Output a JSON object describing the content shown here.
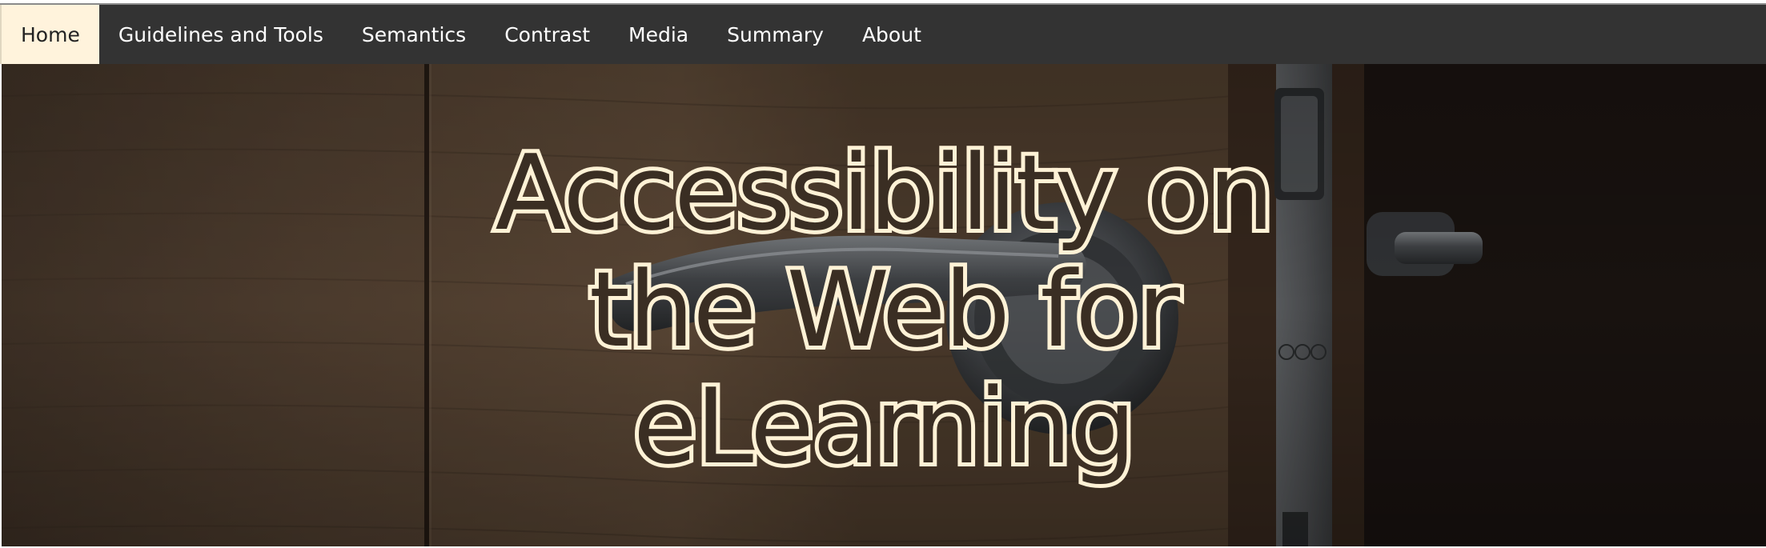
{
  "nav": {
    "items": [
      {
        "label": "Home",
        "active": true
      },
      {
        "label": "Guidelines and Tools",
        "active": false
      },
      {
        "label": "Semantics",
        "active": false
      },
      {
        "label": "Contrast",
        "active": false
      },
      {
        "label": "Media",
        "active": false
      },
      {
        "label": "Summary",
        "active": false
      },
      {
        "label": "About",
        "active": false
      }
    ]
  },
  "hero": {
    "title_lines": [
      "Accessibility on",
      "the Web for",
      "eLearning"
    ],
    "image_description": "door-handle-image"
  },
  "colors": {
    "navbar_bg": "#333333",
    "nav_active_bg": "#fff3dc",
    "title_outline": "#fff2d6"
  }
}
